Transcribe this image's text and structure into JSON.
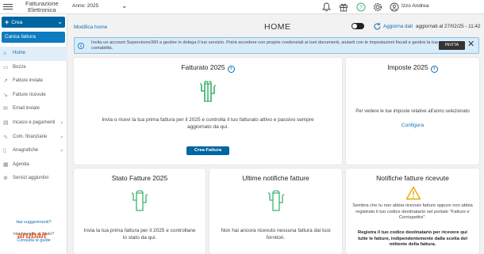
{
  "app": {
    "title_line1": "Fatturazione",
    "title_line2": "Elettronica"
  },
  "topbar": {
    "year_label": "Anno: 2025",
    "user_name": "Izzo Andrea"
  },
  "sidebar": {
    "crea_label": "Crea",
    "carica_label": "Carica fattura",
    "items": [
      {
        "label": "Home",
        "icon": "home-icon",
        "active": true
      },
      {
        "label": "Bozze",
        "icon": "draft-icon"
      },
      {
        "label": "Fatture inviate",
        "icon": "send-icon"
      },
      {
        "label": "Fatture ricevute",
        "icon": "inbox-icon"
      },
      {
        "label": "Email inviate",
        "icon": "email-icon"
      },
      {
        "label": "Incassi e pagamenti",
        "icon": "wallet-icon",
        "chevron": true
      },
      {
        "label": "Com. finanziarie",
        "icon": "chart-icon",
        "chevron": true
      },
      {
        "label": "Anagrafiche",
        "icon": "address-book-icon",
        "chevron": true
      },
      {
        "label": "Agenda",
        "icon": "calendar-icon"
      },
      {
        "label": "Servizi aggiuntivi",
        "icon": "plus-circle-icon"
      }
    ],
    "suggestions": "Hai suggerimenti?",
    "help_line1": "Hai bisogno di aiuto?",
    "help_line2": "Consulta le guide",
    "logo": "arubait"
  },
  "main": {
    "modifica_home": "Modifica home",
    "title": "HOME",
    "aggiorna_dati": "Aggiorna dati",
    "aggiornato": "aggiornati al 27/02/25 - 11:42",
    "banner_text": "Invita un account Supervisore360 a gestire in delega il tuo servizio. Potrà accedere con proprie credenziali ai tuoi documenti, aiutarti con le impostazioni fiscali e gestire la tua contabilità.",
    "banner_button": "INVITA"
  },
  "cards": {
    "fatturato": {
      "title": "Fatturato 2025",
      "text": "Invia o ricevi la tua prima fattura per il 2025 e controlla il tuo fatturato attivo e passivo sempre aggiornato da qui.",
      "button": "Crea Fattura"
    },
    "imposte": {
      "title": "Imposte 2025",
      "text": "Per vedere le tue imposte relative all'anno selezionato",
      "link": "Configura"
    },
    "stato": {
      "title": "Stato Fatture 2025",
      "text": "Invia la tua prima fattura per il 2025 e controllane lo stato da qui."
    },
    "notifiche": {
      "title": "Ultime notifiche fatture",
      "text": "Non hai ancora ricevuto nessuna fattura dai tuoi fornitori."
    },
    "ricevute": {
      "title": "Notifiche fatture ricevute",
      "text": "Sembra che tu non abbia ricevuto fatture oppure non abbia registrato il tuo codice destinatario nel portale \"Fatture e Corrispettivi\".",
      "bold_text": "Registra il tuo codice destinatario per ricevere qui tutte le fatture, indipendentemente dalla scelta del mittente della fattura."
    }
  },
  "colors": {
    "primary": "#0066a1",
    "link": "#0d6fb8",
    "cactus": "#3cb371",
    "warning": "#f0a500",
    "banner_bg": "#d7ebf9"
  }
}
